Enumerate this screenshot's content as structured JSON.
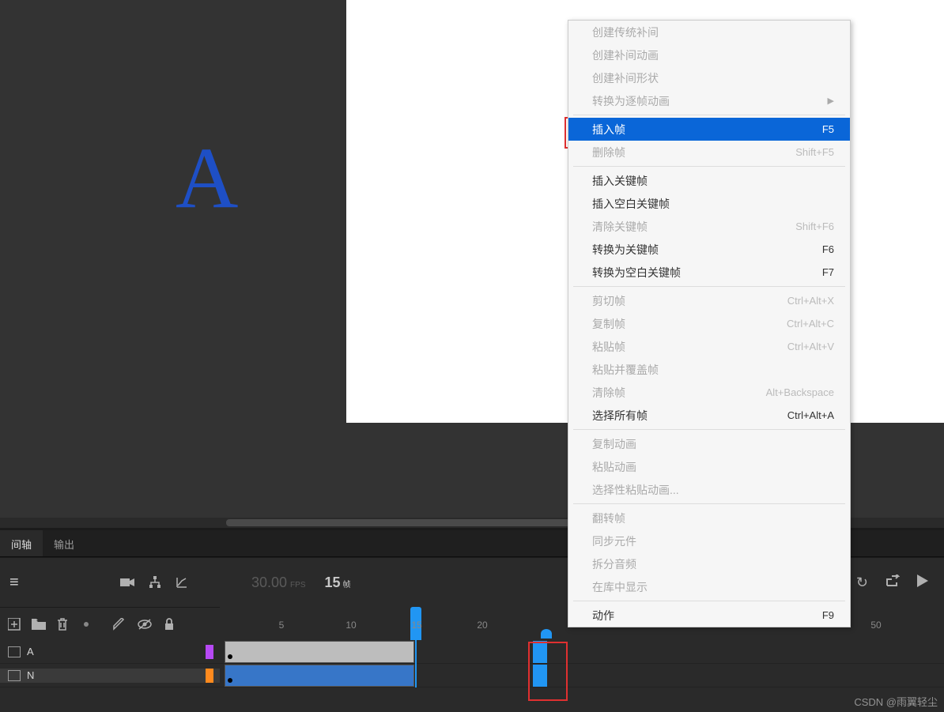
{
  "stage": {
    "glyph": "A"
  },
  "tabs": {
    "timeline": "间轴",
    "output": "输出"
  },
  "toolbar": {
    "fps_value": "30.00",
    "fps_label": "FPS",
    "frame_value": "15",
    "frame_label": "帧"
  },
  "ruler": {
    "ticks": [
      5,
      10,
      15,
      20,
      50
    ]
  },
  "layers": [
    {
      "name": "A",
      "color": "#b749f5",
      "active": false
    },
    {
      "name": "N",
      "color": "#ff8a1e",
      "active": true
    }
  ],
  "menu": {
    "groups": [
      [
        {
          "label": "创建传统补间",
          "disabled": true
        },
        {
          "label": "创建补间动画",
          "disabled": true
        },
        {
          "label": "创建补间形状",
          "disabled": true
        },
        {
          "label": "转换为逐帧动画",
          "disabled": true,
          "submenu": true
        }
      ],
      [
        {
          "label": "插入帧",
          "shortcut": "F5",
          "selected": true
        },
        {
          "label": "删除帧",
          "shortcut": "Shift+F5",
          "disabled": true
        }
      ],
      [
        {
          "label": "插入关键帧"
        },
        {
          "label": "插入空白关键帧"
        },
        {
          "label": "清除关键帧",
          "shortcut": "Shift+F6",
          "disabled": true
        },
        {
          "label": "转换为关键帧",
          "shortcut": "F6"
        },
        {
          "label": "转换为空白关键帧",
          "shortcut": "F7"
        }
      ],
      [
        {
          "label": "剪切帧",
          "shortcut": "Ctrl+Alt+X",
          "disabled": true
        },
        {
          "label": "复制帧",
          "shortcut": "Ctrl+Alt+C",
          "disabled": true
        },
        {
          "label": "粘贴帧",
          "shortcut": "Ctrl+Alt+V",
          "disabled": true
        },
        {
          "label": "粘贴并覆盖帧",
          "disabled": true
        },
        {
          "label": "清除帧",
          "shortcut": "Alt+Backspace",
          "disabled": true
        },
        {
          "label": "选择所有帧",
          "shortcut": "Ctrl+Alt+A"
        }
      ],
      [
        {
          "label": "复制动画",
          "disabled": true
        },
        {
          "label": "粘贴动画",
          "disabled": true
        },
        {
          "label": "选择性粘贴动画...",
          "disabled": true
        }
      ],
      [
        {
          "label": "翻转帧",
          "disabled": true
        },
        {
          "label": "同步元件",
          "disabled": true
        },
        {
          "label": "拆分音频",
          "disabled": true
        },
        {
          "label": "在库中显示",
          "disabled": true
        }
      ],
      [
        {
          "label": "动作",
          "shortcut": "F9"
        }
      ]
    ]
  },
  "watermark": "CSDN @雨翼轻尘"
}
